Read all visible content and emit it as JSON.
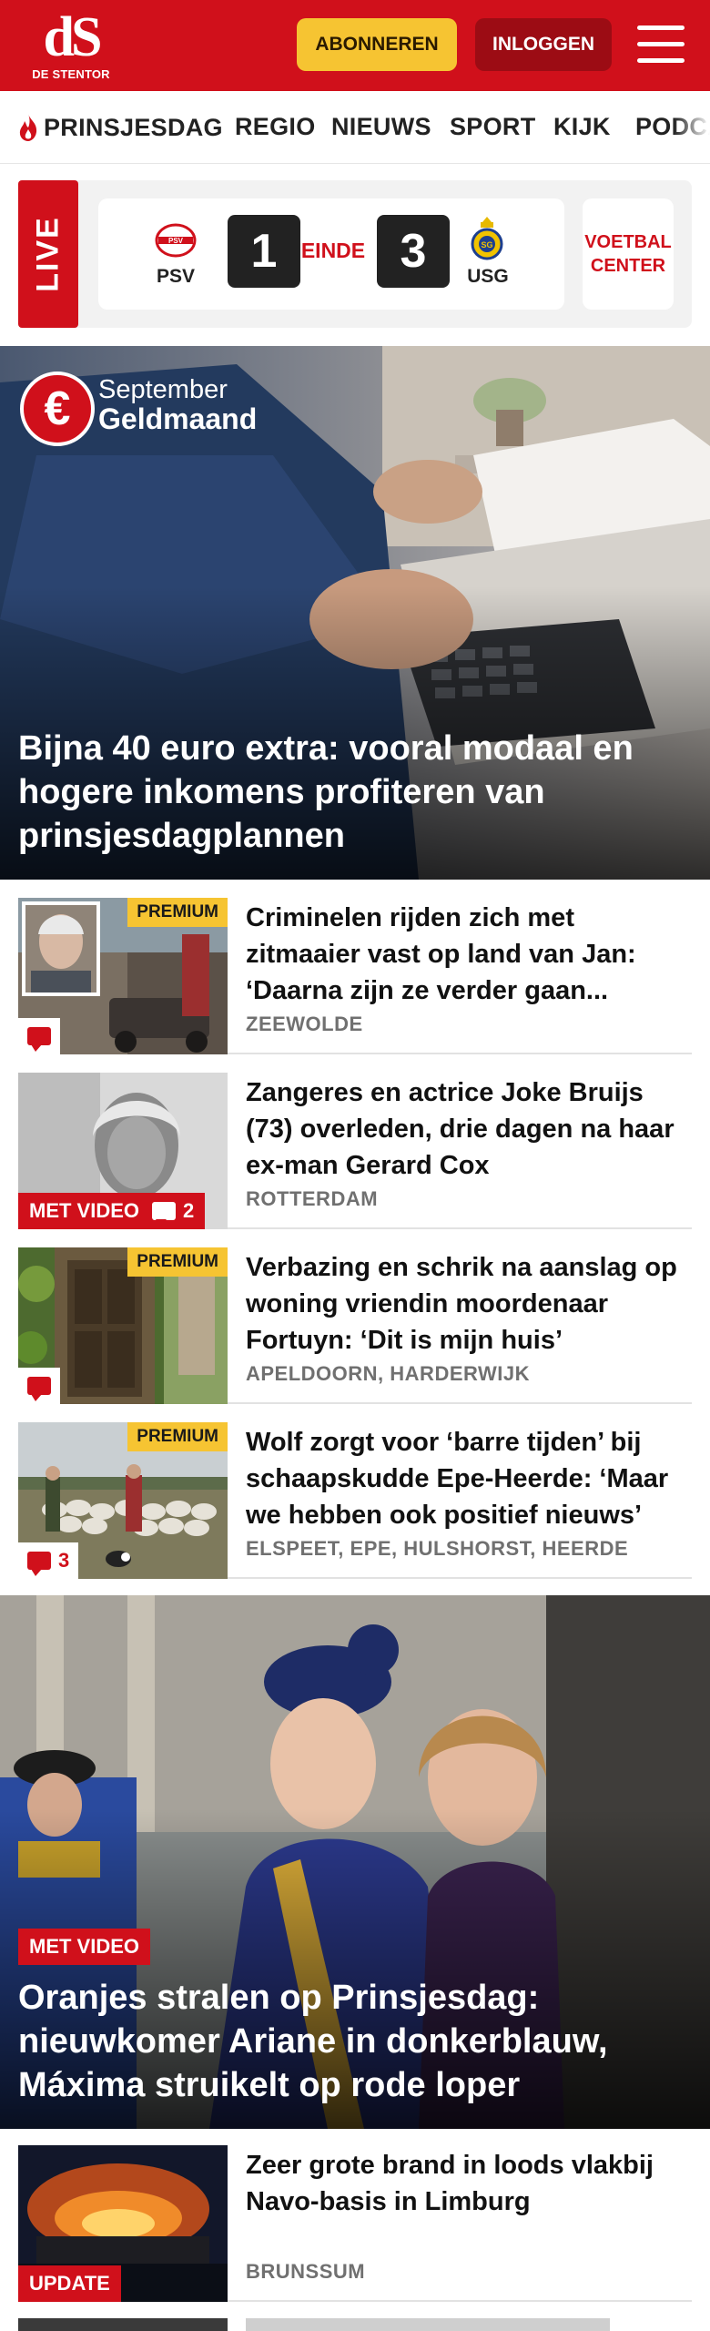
{
  "header": {
    "logo_mark": "dS",
    "logo_sub": "DE STENTOR",
    "subscribe_label": "ABONNEREN",
    "login_label": "INLOGGEN",
    "menu_icon": "hamburger-icon",
    "brand_color": "#d0101b"
  },
  "nav": {
    "items": [
      {
        "label": "PRINSJESDAG",
        "icon": "flame-icon"
      },
      {
        "label": "REGIO"
      },
      {
        "label": "NIEUWS"
      },
      {
        "label": "SPORT"
      },
      {
        "label": "KIJK"
      },
      {
        "label": "PODCA"
      }
    ]
  },
  "live": {
    "tag": "LIVE",
    "home_team": "PSV",
    "home_score": "1",
    "status": "EINDE",
    "away_score": "3",
    "away_team": "USG",
    "voetbal_label": "VOETBAL CENTER"
  },
  "hero1": {
    "badge_symbol": "€",
    "badge_line1": "September",
    "badge_line2": "Geldmaand",
    "title": "Bijna 40 euro extra: vooral modaal en hogere inkomens profiteren van prinsjesdagplannen"
  },
  "articles": [
    {
      "title": "Criminelen rijden zich met zitmaaier vast op land van Jan: ‘Daarna zijn ze verder gaan...",
      "location": "ZEEWOLDE",
      "premium": "PREMIUM",
      "comment_icon": "comment-icon"
    },
    {
      "title": "Zangeres en actrice Joke Bruijs (73) overleden, drie dagen na haar ex-man Gerard Cox",
      "location": "ROTTERDAM",
      "video": "MET VIDEO",
      "comments": "2"
    },
    {
      "title": "Verbazing en schrik na aanslag op woning vriendin moordenaar Fortuyn: ‘Dit is mijn huis’",
      "location": "APELDOORN, HARDERWIJK",
      "premium": "PREMIUM",
      "comment_icon": "comment-icon"
    },
    {
      "title": "Wolf zorgt voor ‘barre tijden’ bij schaapskudde Epe-Heerde: ‘Maar we hebben ook positief nieuws’",
      "location": "ELSPEET, EPE, HULSHORST, HEERDE",
      "premium": "PREMIUM",
      "comments": "3"
    }
  ],
  "hero2": {
    "video": "MET VIDEO",
    "title": "Oranjes stralen op Prinsjesdag: nieuwkomer Ariane in donkerblauw, Máxima struikelt op rode loper"
  },
  "last_article": {
    "title": "Zeer grote brand in loods vlakbij Navo-basis in Limburg",
    "location": "BRUNSSUM",
    "tag": "UPDATE"
  }
}
